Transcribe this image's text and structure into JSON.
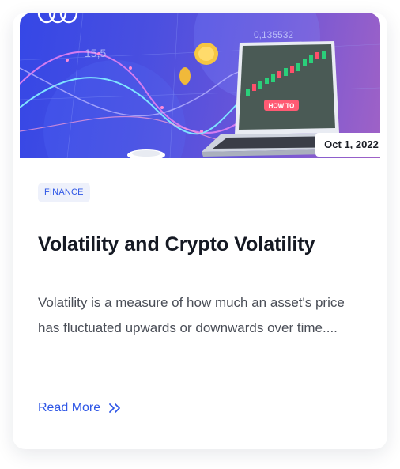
{
  "post": {
    "date": "Oct 1, 2022",
    "category": "FINANCE",
    "title": "Volatility and Crypto Volatility",
    "excerpt": "Volatility is a measure of how much an asset's price has fluctuated upwards or downwards over time....",
    "read_more_label": "Read More",
    "read_more_icon": "double-chevron-right-icon"
  },
  "hero_image": {
    "laptop_badge": "HOW TO",
    "chart_number_a": "0,135532",
    "chart_number_b": "15,5"
  },
  "colors": {
    "accent": "#2f57e6",
    "tag_bg": "#eef1fb",
    "title": "#151923",
    "text": "#4a4e57"
  }
}
